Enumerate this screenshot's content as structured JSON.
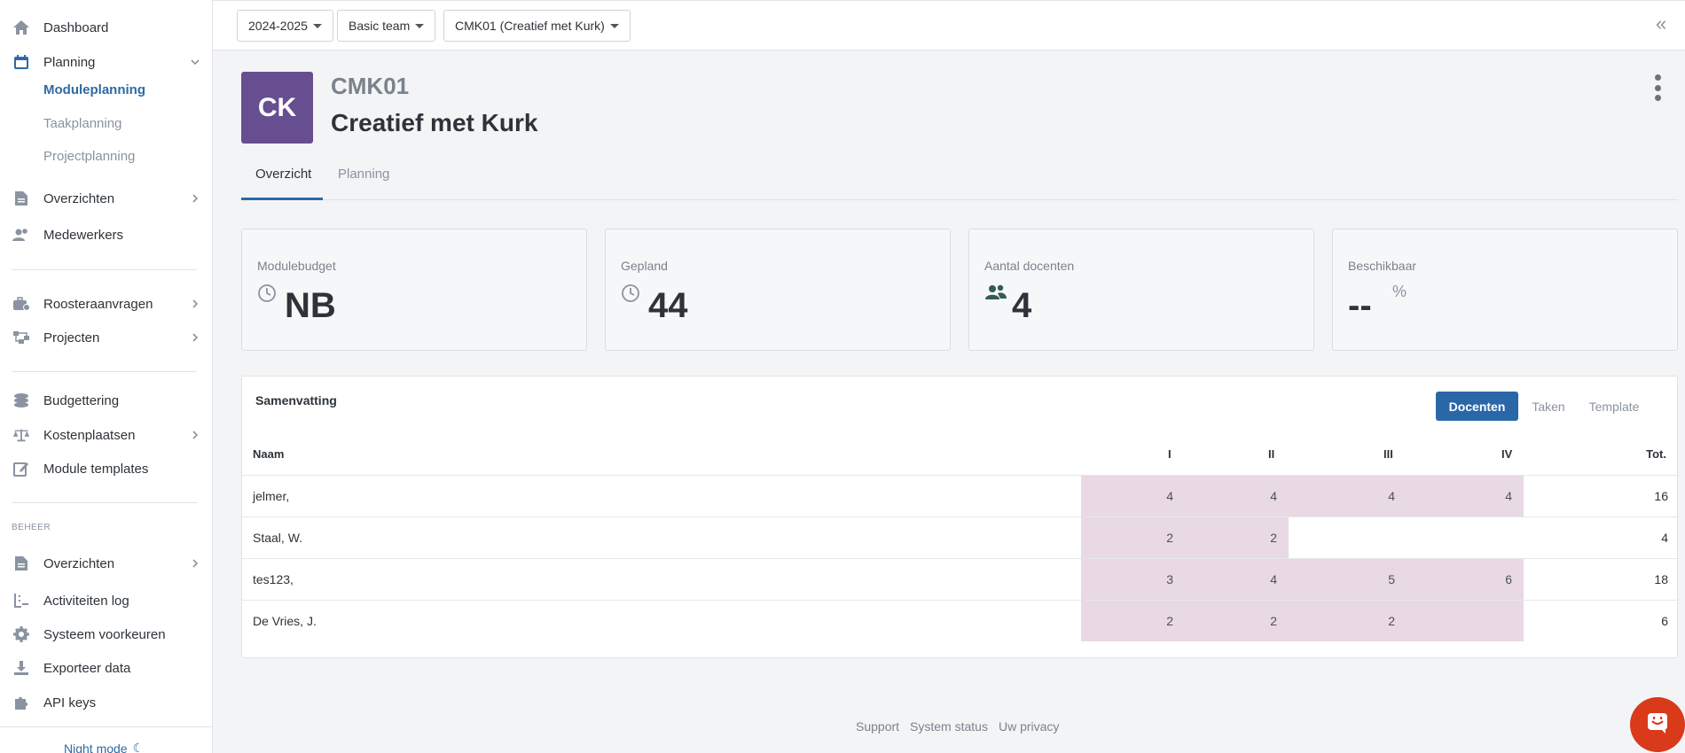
{
  "sidebar": {
    "items": [
      {
        "label": "Dashboard",
        "icon": "home-icon"
      },
      {
        "label": "Planning",
        "icon": "calendar-icon"
      },
      {
        "label": "Overzichten",
        "icon": "document-icon"
      },
      {
        "label": "Medewerkers",
        "icon": "users-icon"
      },
      {
        "label": "Roosteraanvragen",
        "icon": "briefcase-icon"
      },
      {
        "label": "Projecten",
        "icon": "sitemap-icon"
      },
      {
        "label": "Budgettering",
        "icon": "coins-icon"
      },
      {
        "label": "Kostenplaatsen",
        "icon": "balance-scale-icon"
      },
      {
        "label": "Module templates",
        "icon": "edit-icon"
      },
      {
        "label": "Overzichten",
        "icon": "document-icon"
      },
      {
        "label": "Activiteiten log",
        "icon": "log-icon"
      },
      {
        "label": "Systeem voorkeuren",
        "icon": "gear-icon"
      },
      {
        "label": "Exporteer data",
        "icon": "download-icon"
      },
      {
        "label": "API keys",
        "icon": "puzzle-icon"
      }
    ],
    "planning_sub": [
      "Moduleplanning",
      "Taakplanning",
      "Projectplanning"
    ],
    "section_label": "BEHEER",
    "night_mode": "Night mode"
  },
  "topbar": {
    "year": "2024-2025",
    "team": "Basic team",
    "module": "CMK01 (Creatief met Kurk)"
  },
  "header": {
    "avatar": "CK",
    "code": "CMK01",
    "title": "Creatief met Kurk"
  },
  "tabs": [
    "Overzicht",
    "Planning"
  ],
  "cards": [
    {
      "label": "Modulebudget",
      "value": "NB",
      "icon": "clock-icon"
    },
    {
      "label": "Gepland",
      "value": "44",
      "icon": "clock-icon"
    },
    {
      "label": "Aantal docenten",
      "value": "4",
      "icon": "users-icon"
    },
    {
      "label": "Beschikbaar",
      "value": "--",
      "unit": "%"
    }
  ],
  "summary": {
    "title": "Samenvatting",
    "toggles": [
      "Docenten",
      "Taken",
      "Template"
    ],
    "columns": [
      "Naam",
      "I",
      "II",
      "III",
      "IV",
      "Tot."
    ],
    "rows": [
      {
        "name": "jelmer,",
        "values": [
          "4",
          "4",
          "4",
          "4"
        ],
        "total": "16"
      },
      {
        "name": "Staal, W.",
        "values": [
          "2",
          "2",
          "",
          ""
        ],
        "total": "4"
      },
      {
        "name": "tes123,",
        "values": [
          "3",
          "4",
          "5",
          "6"
        ],
        "total": "18"
      },
      {
        "name": "De Vries, J.",
        "values": [
          "2",
          "2",
          "2",
          ""
        ],
        "total": "6"
      }
    ],
    "highlight_color": "#e9d9e4"
  },
  "footer": [
    "Support",
    "System status",
    "Uw privacy"
  ],
  "colors": {
    "accent": "#2a67a7",
    "avatar": "#674e91",
    "chat": "#d93a1a"
  }
}
